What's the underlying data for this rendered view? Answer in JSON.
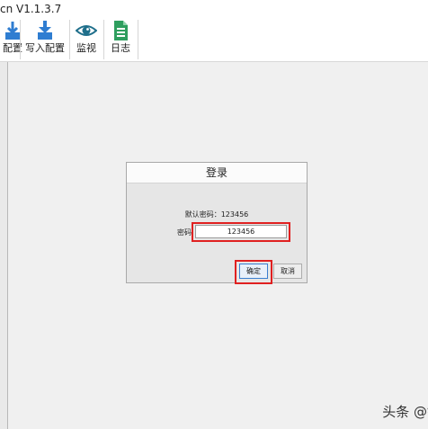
{
  "window": {
    "title": "cn V1.1.3.7"
  },
  "toolbar": {
    "items": [
      {
        "label": "配置",
        "icon": "download-config-icon",
        "color": "#2f7dd1"
      },
      {
        "label": "写入配置",
        "icon": "write-config-icon",
        "color": "#2f7dd1"
      },
      {
        "label": "监视",
        "icon": "eye-icon",
        "color": "#1f6f8b"
      },
      {
        "label": "日志",
        "icon": "log-icon",
        "color": "#2e9e5e"
      }
    ]
  },
  "dialog": {
    "title": "登录",
    "hint": "默认密码：123456",
    "password_label": "密码",
    "password_value": "123456",
    "ok_label": "确定",
    "cancel_label": "取消",
    "highlight_color": "#e02020"
  },
  "watermark": "头条 @钡"
}
